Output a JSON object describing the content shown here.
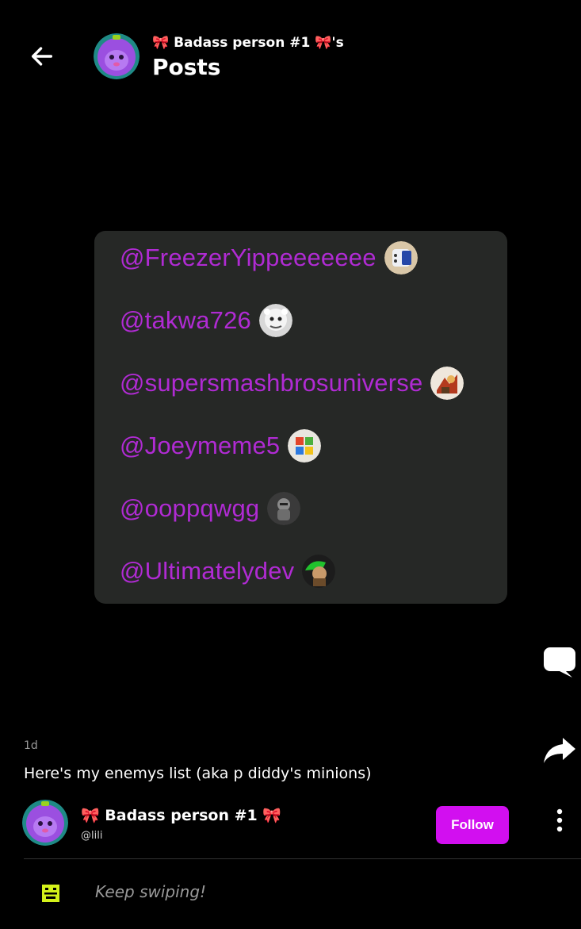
{
  "header": {
    "subtitle": "🎀 Badass person #1 🎀's",
    "title": "Posts"
  },
  "post": {
    "mentions": [
      {
        "handle": "@FreezerYippeeeeeee",
        "icon": "jar-avatar-icon"
      },
      {
        "handle": "@takwa726",
        "icon": "white-creature-avatar-icon"
      },
      {
        "handle": "@supersmashbrosuniverse",
        "icon": "smash-character-avatar-icon"
      },
      {
        "handle": "@Joeymeme5",
        "icon": "colorful-logo-avatar-icon"
      },
      {
        "handle": "@ooppqwgg",
        "icon": "grey-figure-avatar-icon"
      },
      {
        "handle": "@Ultimatelydev",
        "icon": "green-character-avatar-icon"
      }
    ],
    "time": "1d",
    "caption": "Here's my enemys list (aka p diddy's minions)"
  },
  "author": {
    "name": "🎀 Badass person #1 🎀",
    "handle": "@lili",
    "follow_label": "Follow"
  },
  "footer": {
    "swipe_text": "Keep swiping!"
  },
  "colors": {
    "mention": "#b02bd3",
    "follow_button": "#d20ff0",
    "card_bg": "#262826",
    "swipe_icon": "#d4f21a"
  }
}
